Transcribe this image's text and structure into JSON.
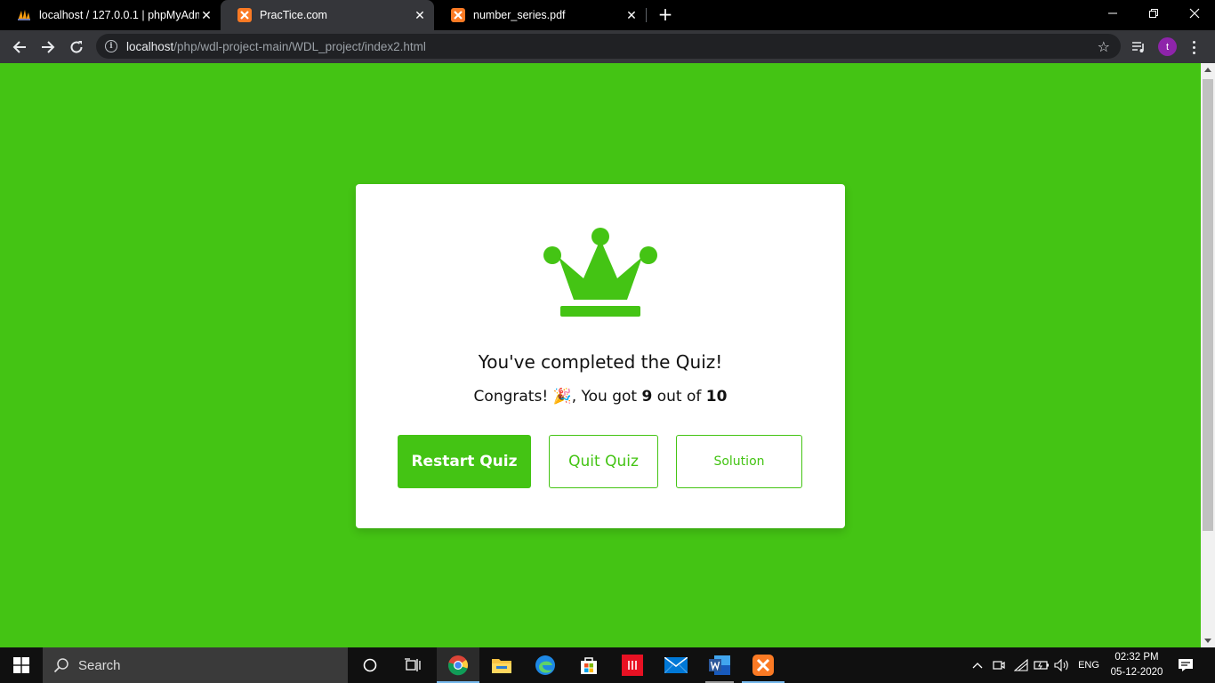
{
  "browser": {
    "tabs": [
      {
        "title": "localhost / 127.0.0.1 | phpMyAdm",
        "active": false
      },
      {
        "title": "PracTice.com",
        "active": true
      },
      {
        "title": "number_series.pdf",
        "active": false
      }
    ],
    "new_tab_label": "+",
    "url_host": "localhost",
    "url_path": "/php/wdl-project-main/WDL_project/index2.html",
    "profile_initial": "t"
  },
  "page": {
    "background_color": "#44c414",
    "accent_color": "#44c414",
    "completed_text": "You've completed the Quiz!",
    "score": {
      "prefix": "Congrats! ",
      "emoji": "🎉",
      "middle": ", You got ",
      "correct": "9",
      "out_of_text": " out of ",
      "total": "10"
    },
    "buttons": {
      "restart": "Restart Quiz",
      "quit": "Quit Quiz",
      "solution": "Solution"
    }
  },
  "taskbar": {
    "search_label": "Search",
    "language": "ENG",
    "time": "02:32 PM",
    "date": "05-12-2020"
  }
}
